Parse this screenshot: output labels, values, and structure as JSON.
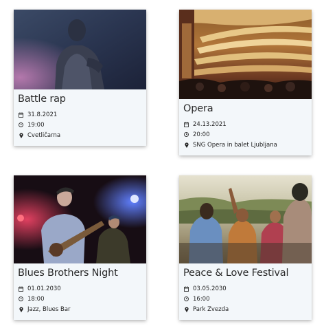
{
  "events": [
    {
      "title": "Battle rap",
      "date": "31.8.2021",
      "time": "19:00",
      "location": "Cvetličarna",
      "image": "rapper-performing-photo"
    },
    {
      "title": "Opera",
      "date": "24.13.2021",
      "time": "20:00",
      "location": "SNG Opera in balet Ljubljana",
      "image": "opera-house-interior-photo"
    },
    {
      "title": "Blues Brothers Night",
      "date": "01.01.2030",
      "time": "18:00",
      "location": "Jazz, Blues Bar",
      "image": "guitarist-on-stage-photo"
    },
    {
      "title": "Peace & Love Festival",
      "date": "03.05.2030",
      "time": "16:00",
      "location": "Park Zvezda",
      "image": "festival-crowd-photo"
    }
  ],
  "icons": {
    "date": "calendar-icon",
    "time": "clock-icon",
    "location": "map-pin-icon"
  }
}
